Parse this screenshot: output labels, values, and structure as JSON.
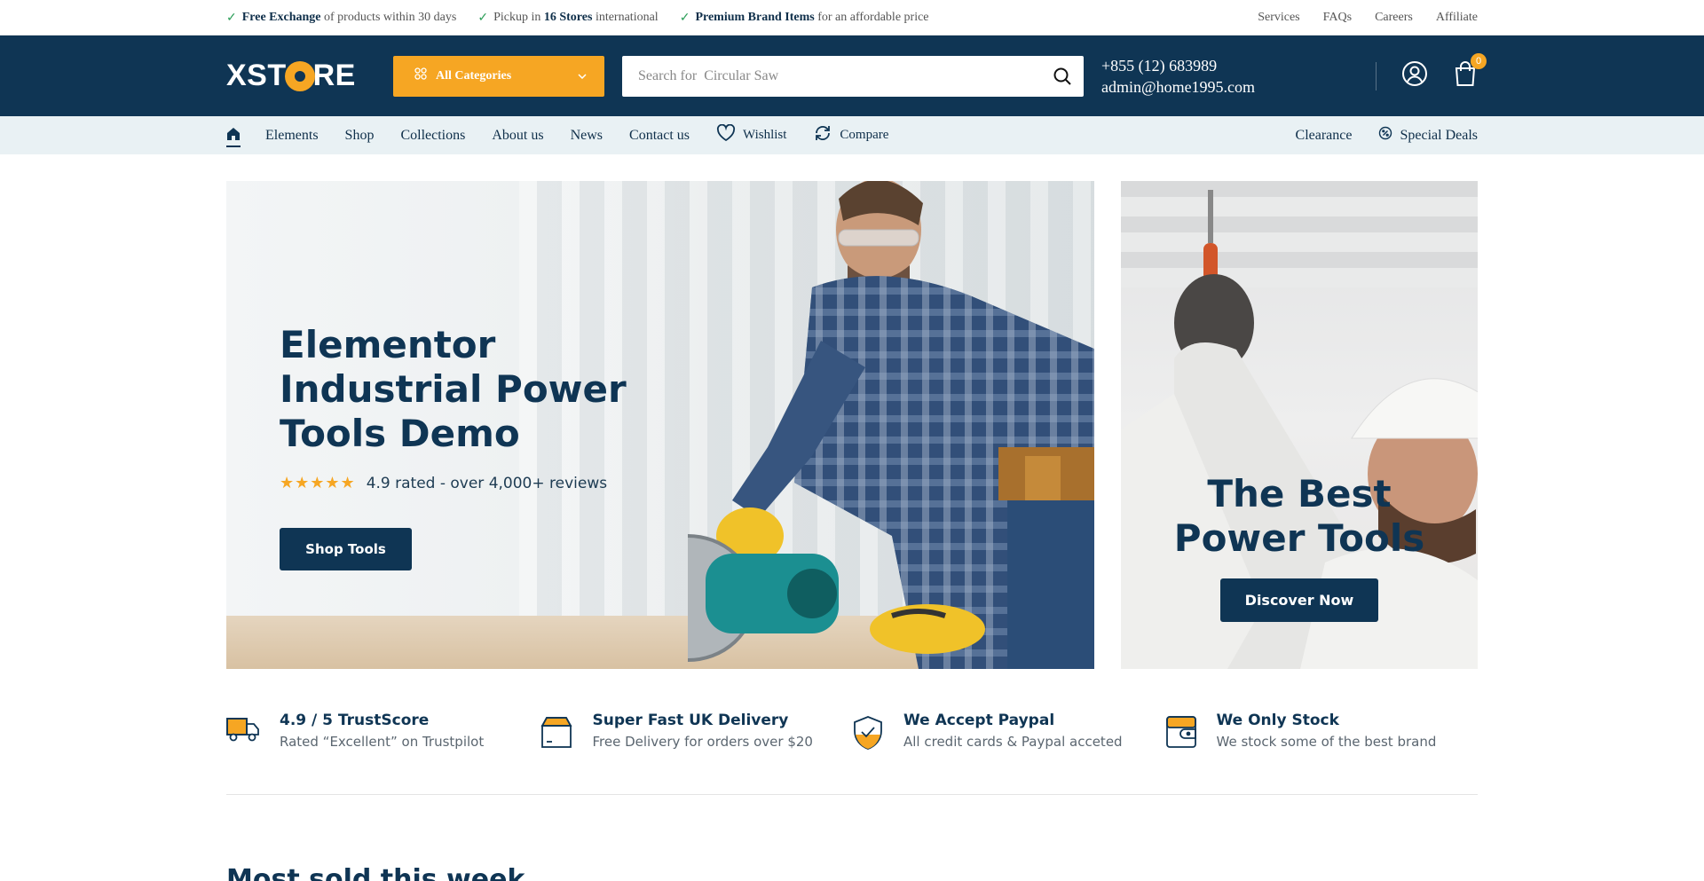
{
  "topbar": {
    "promos": [
      {
        "bold": "Free Exchange",
        "text": " of products within 30 days"
      },
      {
        "pre": "Pickup in ",
        "bold": "16 Stores",
        "text": " international"
      },
      {
        "bold": "Premium Brand Items",
        "text": " for an affordable price"
      }
    ],
    "links": [
      "Services",
      "FAQs",
      "Careers",
      "Affiliate"
    ]
  },
  "header": {
    "logo_left": "XST",
    "logo_right": "RE",
    "categories_label": "All Categories",
    "search_placeholder": "Search for  Circular Saw",
    "phone": "+855 (12) 683989",
    "email": "admin@home1995.com",
    "cart_count": "0"
  },
  "nav": {
    "items": [
      "Elements",
      "Shop",
      "Collections",
      "About us",
      "News",
      "Contact us",
      "Wishlist",
      "Compare"
    ],
    "right": [
      "Clearance",
      "Special Deals"
    ]
  },
  "hero": {
    "title": "Elementor Industrial Power Tools Demo",
    "stars": "★★★★★",
    "rating_text": "4.9 rated - over 4,000+ reviews",
    "button": "Shop Tools"
  },
  "side_banner": {
    "title_line1": "The Best",
    "title_line2": "Power Tools",
    "button": "Discover Now"
  },
  "features": [
    {
      "icon": "truck-icon",
      "title": "4.9 / 5 TrustScore",
      "sub": "Rated “Excellent” on Trustpilot"
    },
    {
      "icon": "box-icon",
      "title": "Super Fast UK Delivery",
      "sub": "Free Delivery for orders over $20"
    },
    {
      "icon": "shield-check-icon",
      "title": "We Accept Paypal",
      "sub": "All credit cards & Paypal acceted"
    },
    {
      "icon": "wallet-icon",
      "title": "We Only Stock",
      "sub": "We stock some of the best brand"
    }
  ],
  "section_title": "Most sold this week",
  "colors": {
    "navy": "#0f3554",
    "accent": "#f6a623",
    "nav_bg": "#e9f1f4",
    "check": "#2e9f5a"
  }
}
